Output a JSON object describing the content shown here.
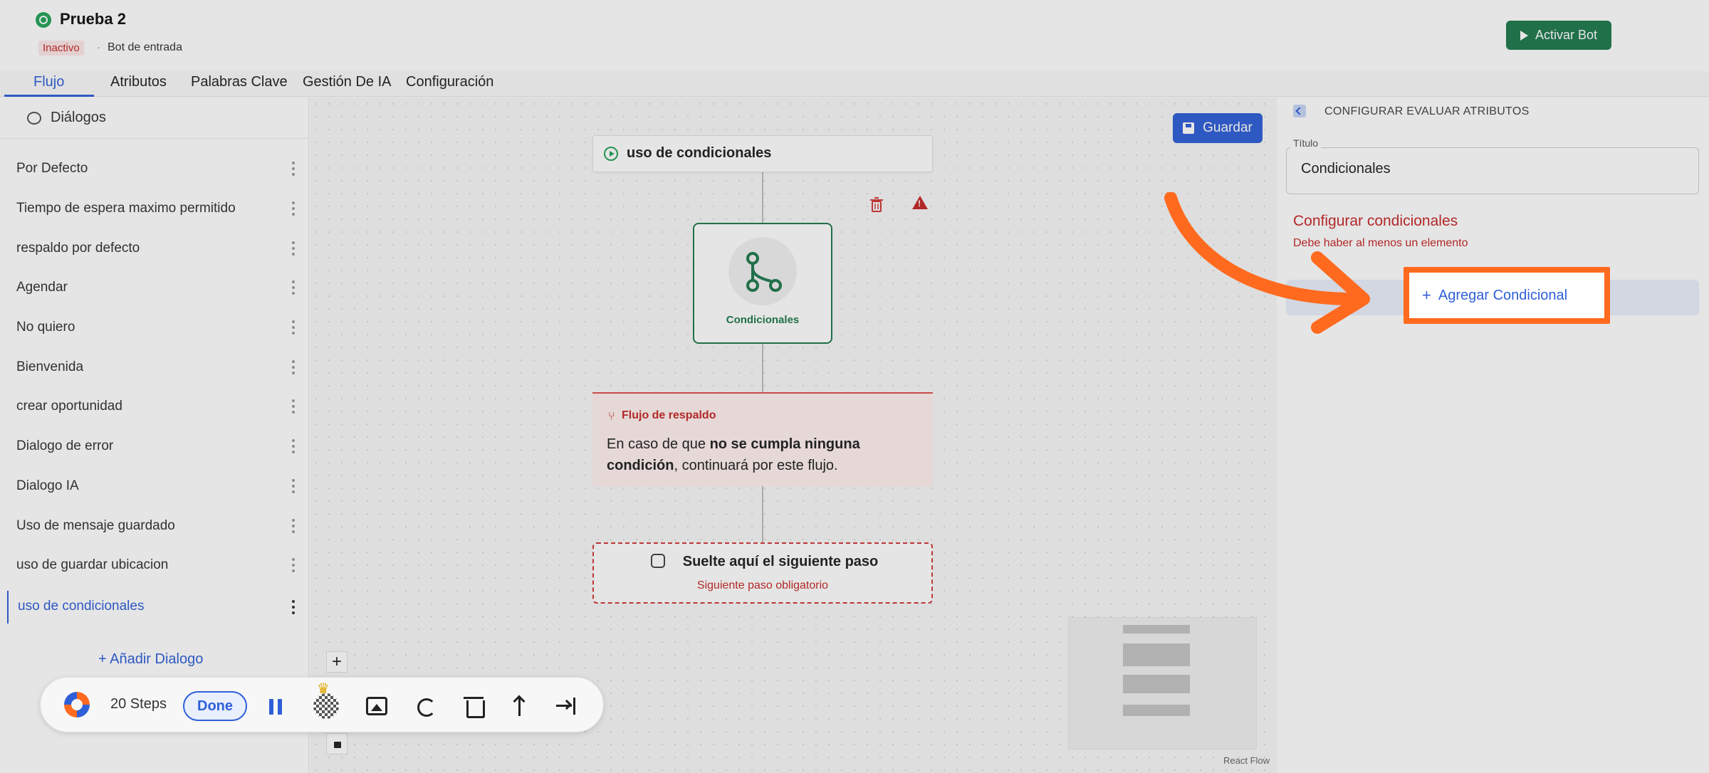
{
  "header": {
    "bot_name": "Prueba 2",
    "status": "Inactivo",
    "separator": "·",
    "bot_type": "Bot de entrada",
    "activate_label": "Activar Bot"
  },
  "tabs": [
    {
      "label": "Flujo",
      "active": true
    },
    {
      "label": "Atributos"
    },
    {
      "label": "Palabras Clave"
    },
    {
      "label": "Gestión De IA"
    },
    {
      "label": "Configuración"
    }
  ],
  "sidebar": {
    "title": "Diálogos",
    "items": [
      {
        "label": "Por Defecto"
      },
      {
        "label": "Tiempo de espera maximo permitido"
      },
      {
        "label": "respaldo por defecto"
      },
      {
        "label": "Agendar"
      },
      {
        "label": "No quiero"
      },
      {
        "label": "Bienvenida"
      },
      {
        "label": "crear oportunidad"
      },
      {
        "label": "Dialogo de error"
      },
      {
        "label": "Dialogo IA"
      },
      {
        "label": "Uso de mensaje guardado"
      },
      {
        "label": "uso de guardar ubicacion"
      },
      {
        "label": "uso de condicionales",
        "selected": true
      }
    ],
    "add_label": "+ Añadir Dialogo"
  },
  "canvas": {
    "save_label": "Guardar",
    "flow_title": "uso de condicionales",
    "node_label": "Condicionales",
    "fallback": {
      "title": "Flujo de respaldo",
      "text_prefix": "En caso de que ",
      "text_bold": "no se cumpla ninguna condición",
      "text_suffix": ", continuará por este flujo."
    },
    "drop_zone": {
      "title": "Suelte aquí el siguiente paso",
      "subtitle": "Siguiente paso obligatorio"
    },
    "zoom_in": "+",
    "attribution": "React Flow"
  },
  "panel": {
    "title": "CONFIGURAR EVALUAR ATRIBUTOS",
    "field_label": "Título",
    "field_value": "Condicionales",
    "conditions_heading": "Configurar condicionales",
    "conditions_error": "Debe haber al menos un elemento",
    "add_conditional_label": "Agregar Condicional",
    "add_conditional_plus": "+"
  },
  "recorder": {
    "steps": "20 Steps",
    "done_label": "Done",
    "crown": "♛"
  },
  "colors": {
    "primary": "#2f5fd8",
    "success": "#1f7a4f",
    "danger": "#c62828",
    "highlight": "#ff6a1f"
  },
  "icons": [
    "whatsapp-icon",
    "play-icon",
    "dialogs-icon",
    "kebab-icon",
    "save-icon",
    "start-icon",
    "trash-icon",
    "warning-icon",
    "branch-icon",
    "fallback-icon",
    "drop-icon",
    "lock-icon",
    "back-icon",
    "plus-icon",
    "arrow-icon",
    "pause-icon",
    "crown-icon",
    "blur-icon",
    "image-icon",
    "undo-icon",
    "upload-icon",
    "skip-icon"
  ]
}
